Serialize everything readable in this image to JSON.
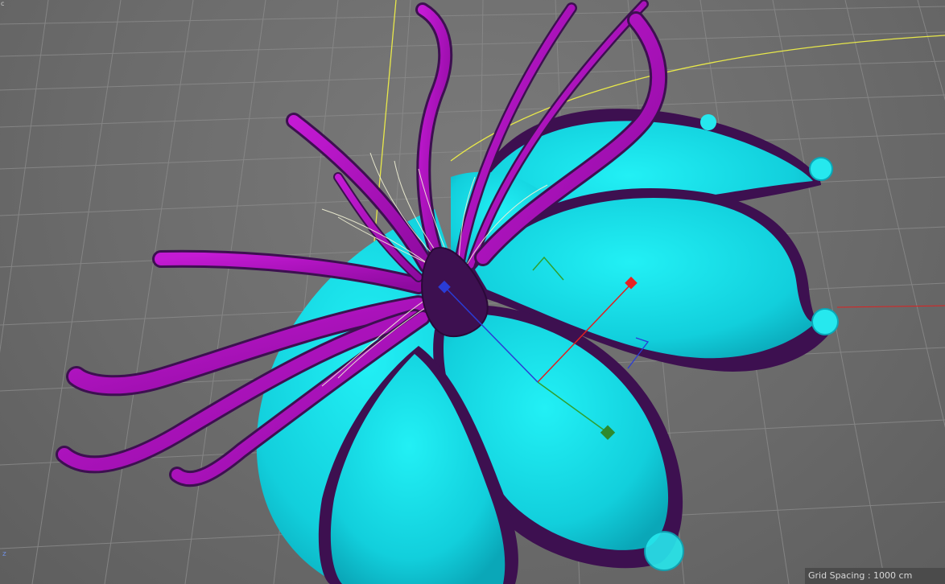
{
  "viewport": {
    "grid_spacing_text": "Grid Spacing : 1000 cm",
    "axis_indicator": "z",
    "colors": {
      "grid_bg": "#6e6e6e",
      "grid_line": "#8a8a8a",
      "petal_cyan": "#14d6e0",
      "petal_edge": "#3d1050",
      "tendril_magenta": "#b212c4",
      "selection_yellow": "#e8e84a",
      "axis_x": "#e02020",
      "axis_y": "#2fa02f",
      "axis_z": "#2a3cd6"
    }
  }
}
